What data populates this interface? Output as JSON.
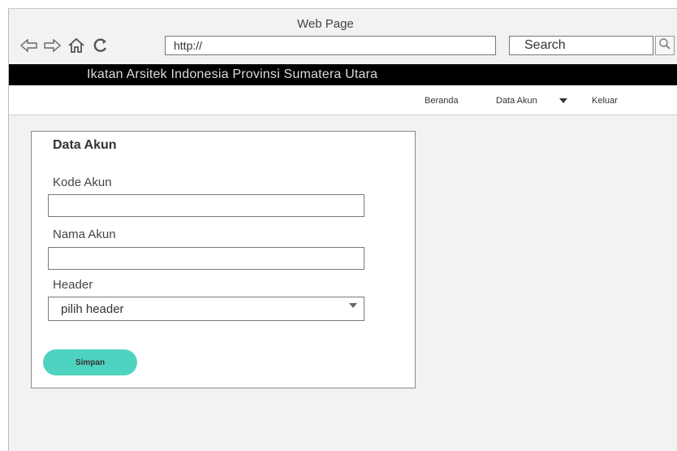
{
  "window": {
    "title": "Web Page"
  },
  "toolbar": {
    "icons": [
      "back-arrow-icon",
      "forward-arrow-icon",
      "home-icon",
      "refresh-icon",
      "magnifier-icon"
    ],
    "url_value": "http://",
    "search_value": "Search"
  },
  "banner": {
    "title": "Ikatan Arsitek Indonesia Provinsi Sumatera Utara"
  },
  "menu": {
    "items": [
      {
        "label": "Beranda"
      },
      {
        "label": "Data Akun"
      },
      {
        "label": "Keluar"
      }
    ]
  },
  "form": {
    "title": "Data Akun",
    "kode_label": "Kode Akun",
    "kode_value": "",
    "nama_label": "Nama Akun",
    "nama_value": "",
    "header_label": "Header",
    "header_selected": "pilih header",
    "save_label": "Simpan"
  },
  "colors": {
    "banner_bg": "#000000",
    "save_button": "#4fd3c1",
    "chrome_bg": "#f2f2f2"
  }
}
